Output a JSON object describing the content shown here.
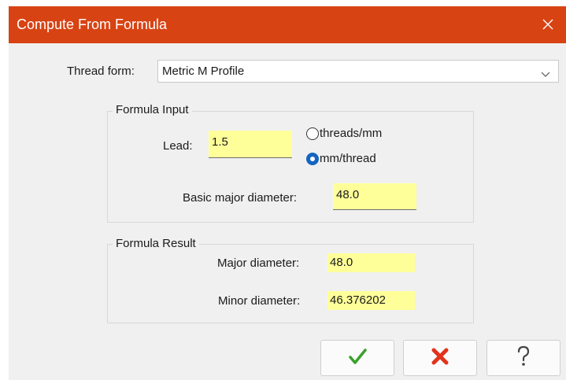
{
  "window": {
    "title": "Compute From Formula",
    "close_icon": "close-icon"
  },
  "thread_form": {
    "label": "Thread form:",
    "value": "Metric M Profile"
  },
  "formula_input": {
    "legend": "Formula Input",
    "lead_label": "Lead:",
    "lead_value": "1.5",
    "units": [
      {
        "label": "threads/mm",
        "selected": false
      },
      {
        "label": "mm/thread",
        "selected": true
      }
    ],
    "basic_major_label": "Basic major diameter:",
    "basic_major_value": "48.0"
  },
  "formula_result": {
    "legend": "Formula Result",
    "major_label": "Major diameter:",
    "major_value": "48.0",
    "minor_label": "Minor diameter:",
    "minor_value": "46.376202"
  },
  "buttons": [
    {
      "icon": "checkmark-icon",
      "color": "#3aa12b"
    },
    {
      "icon": "cross-icon",
      "color": "#e2331d"
    },
    {
      "icon": "question-icon",
      "color": "#444444"
    }
  ]
}
